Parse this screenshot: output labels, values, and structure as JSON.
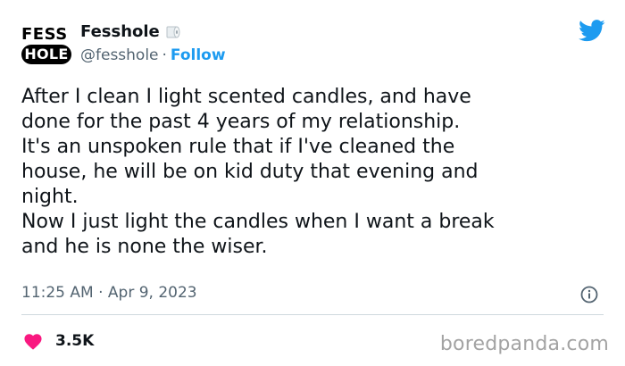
{
  "author": {
    "avatar_text_top": "FESS",
    "avatar_text_bottom": "HOLE",
    "display_name": "Fesshole",
    "name_icon": "toilet-paper-icon",
    "handle": "@fesshole",
    "separator": "·",
    "follow_label": "Follow"
  },
  "brand_icon": "twitter-bird-icon",
  "tweet": {
    "text": "After I clean I light scented candles, and have\ndone for the past 4 years of my relationship.\nIt's an unspoken rule that if I've cleaned the\nhouse, he will be on kid duty that evening and\nnight.\nNow I just light the candles when I want a break\nand he is none the wiser.",
    "time": "11:25 AM",
    "separator": "·",
    "date": "Apr 9, 2023",
    "info_icon": "info-icon"
  },
  "engagement": {
    "like_icon": "heart-icon",
    "likes": "3.5K"
  },
  "watermark": "boredpanda.com",
  "colors": {
    "accent": "#1d9bf0",
    "heart": "#f91880",
    "secondary_text": "#536471"
  }
}
